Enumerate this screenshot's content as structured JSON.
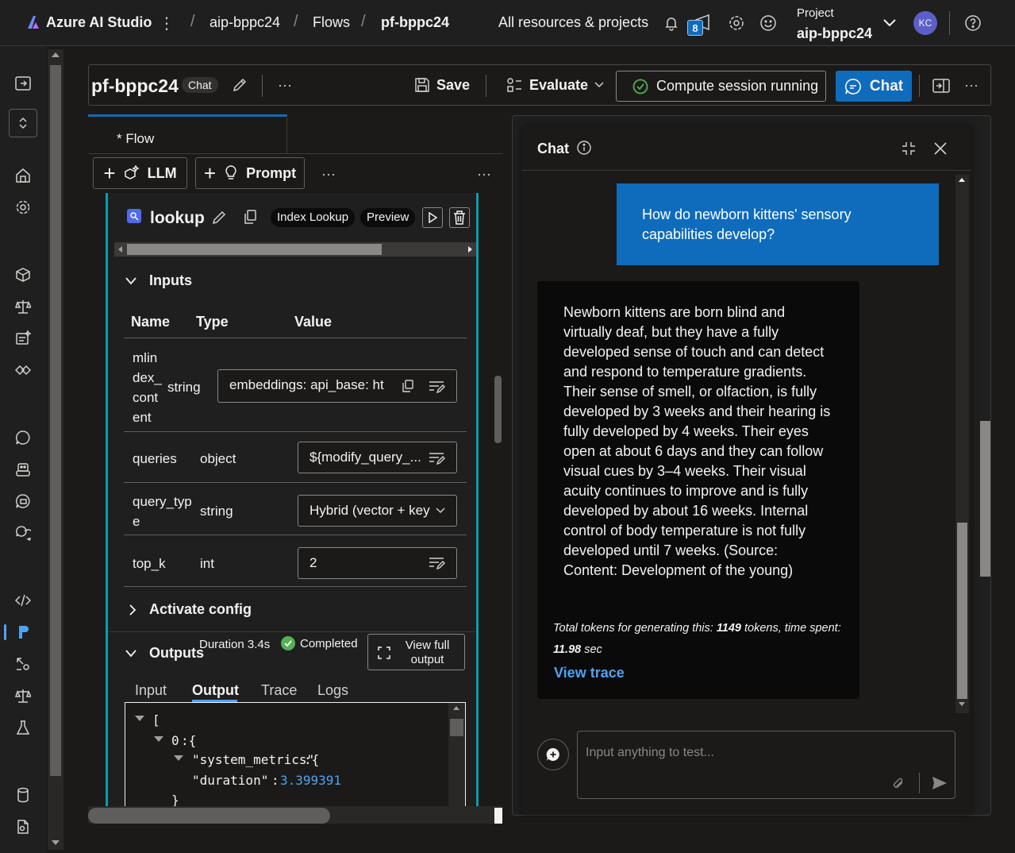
{
  "topbar": {
    "brand": "Azure AI Studio",
    "breadcrumbs": [
      "aip-bppc24",
      "Flows",
      "pf-bppc24"
    ],
    "all_resources": "All resources & projects",
    "notification_count": "8",
    "project_label": "Project",
    "project_name": "aip-bppc24",
    "avatar_initials": "KC"
  },
  "header": {
    "title": "pf-bppc24",
    "chat_badge": "Chat",
    "save_label": "Save",
    "evaluate_label": "Evaluate",
    "compute_status": "Compute session running",
    "chat_button": "Chat"
  },
  "flow": {
    "tab_label": "* Flow",
    "add_llm": "LLM",
    "add_prompt": "Prompt"
  },
  "node": {
    "name": "lookup",
    "tool_badge": "Index Lookup",
    "preview_badge": "Preview",
    "inputs_title": "Inputs",
    "col_name": "Name",
    "col_type": "Type",
    "col_value": "Value",
    "rows": [
      {
        "name": "mlin dex_ cont ent",
        "type": "string",
        "value": "embeddings:  api_base: ht"
      },
      {
        "name": "queries",
        "type": "object",
        "value": "${modify_query_..."
      },
      {
        "name": "query_typ e",
        "type": "string",
        "value": "Hybrid (vector + key"
      },
      {
        "name": "top_k",
        "type": "int",
        "value": "2"
      }
    ],
    "activate_config": "Activate config",
    "outputs_title": "Outputs",
    "duration": "Duration 3.4s",
    "status": "Completed",
    "view_full_output": "View full output",
    "output_tabs": [
      "Input",
      "Output",
      "Trace",
      "Logs"
    ],
    "code": {
      "line1": "[",
      "line2_key": "0",
      "line3_key": "\"system_metrics\"",
      "line4_key": "\"duration\"",
      "line4_val": "3.399391",
      "line5": "}"
    }
  },
  "chat": {
    "title": "Chat",
    "user_message": "How do newborn kittens' sensory capabilities develop?",
    "bot_message": "Newborn kittens are born blind and virtually deaf, but they have a fully developed sense of touch and can detect and respond to temperature gradients. Their sense of smell, or olfaction, is fully developed by 3 weeks and their hearing is fully developed by 4 weeks. Their eyes open at about 6 days and they can follow visual cues by 3–4 weeks. Their visual acuity continues to improve and is fully developed by about 16 weeks. Internal control of body temperature is not fully developed until 7 weeks. (Source: Content: Development of the young)",
    "tokens_prefix": "Total tokens for generating this: ",
    "tokens_value": "1149",
    "tokens_mid": " tokens, time spent: ",
    "time_value": "11.98",
    "time_suffix": " sec",
    "view_trace": "View trace",
    "input_placeholder": "Input anything to test..."
  },
  "colors": {
    "accent": "#0f6cbd",
    "teal": "#00a2ad",
    "success": "#13a10e",
    "link": "#4fa3f7"
  }
}
